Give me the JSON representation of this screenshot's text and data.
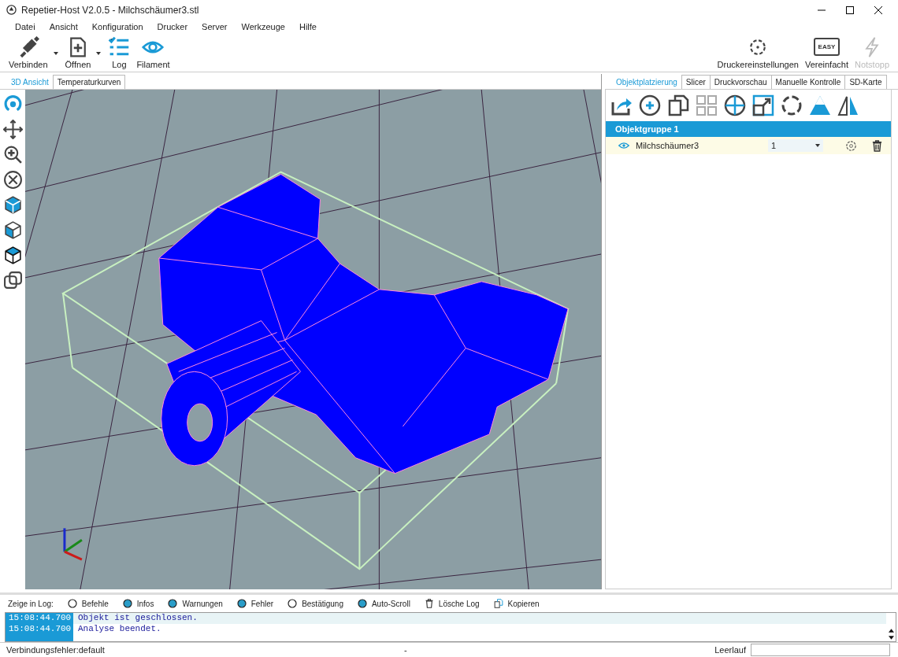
{
  "window": {
    "title": "Repetier-Host V2.0.5 - Milchschäumer3.stl"
  },
  "menu": [
    "Datei",
    "Ansicht",
    "Konfiguration",
    "Drucker",
    "Server",
    "Werkzeuge",
    "Hilfe"
  ],
  "toolbar_left": [
    {
      "label": "Verbinden",
      "kind": "connect",
      "dropdown": true
    },
    {
      "label": "Öffnen",
      "kind": "open",
      "dropdown": true
    },
    {
      "label": "Log",
      "kind": "log",
      "dropdown": false
    },
    {
      "label": "Filament",
      "kind": "filament",
      "dropdown": false
    }
  ],
  "toolbar_right": [
    {
      "label": "Druckereinstellungen",
      "kind": "settings",
      "disabled": false
    },
    {
      "label": "Vereinfacht",
      "kind": "easy",
      "disabled": false,
      "badge": "EASY"
    },
    {
      "label": "Notstopp",
      "kind": "stop",
      "disabled": true
    }
  ],
  "left_tabs": [
    {
      "label": "3D Ansicht",
      "selected": true
    },
    {
      "label": "Temperaturkurven",
      "selected": false
    }
  ],
  "right_tabs": [
    {
      "label": "Objektplatzierung",
      "selected": true
    },
    {
      "label": "Slicer",
      "selected": false
    },
    {
      "label": "Druckvorschau",
      "selected": false
    },
    {
      "label": "Manuelle Kontrolle",
      "selected": false
    },
    {
      "label": "SD-Karte",
      "selected": false
    }
  ],
  "object_group": {
    "title": "Objektgruppe 1",
    "objects": [
      {
        "name": "Milchschäumer3",
        "copies": "1",
        "visible": true
      }
    ]
  },
  "log_filter": {
    "label": "Zeige in Log:",
    "options": [
      {
        "label": "Befehle",
        "kind": "radio",
        "checked": false
      },
      {
        "label": "Infos",
        "kind": "radio",
        "checked": true
      },
      {
        "label": "Warnungen",
        "kind": "radio",
        "checked": true
      },
      {
        "label": "Fehler",
        "kind": "radio",
        "checked": true
      },
      {
        "label": "Bestätigung",
        "kind": "radio",
        "checked": false
      },
      {
        "label": "Auto-Scroll",
        "kind": "radio",
        "checked": true
      },
      {
        "label": "Lösche Log",
        "kind": "trash"
      },
      {
        "label": "Kopieren",
        "kind": "copy"
      }
    ]
  },
  "log": [
    {
      "time": "15:08:44.700",
      "message": "Objekt ist geschlossen."
    },
    {
      "time": "15:08:44.700",
      "message": "Analyse beendet."
    }
  ],
  "status_bar": {
    "left": "Verbindungsfehler:default",
    "center": "-",
    "right": "Leerlauf"
  }
}
